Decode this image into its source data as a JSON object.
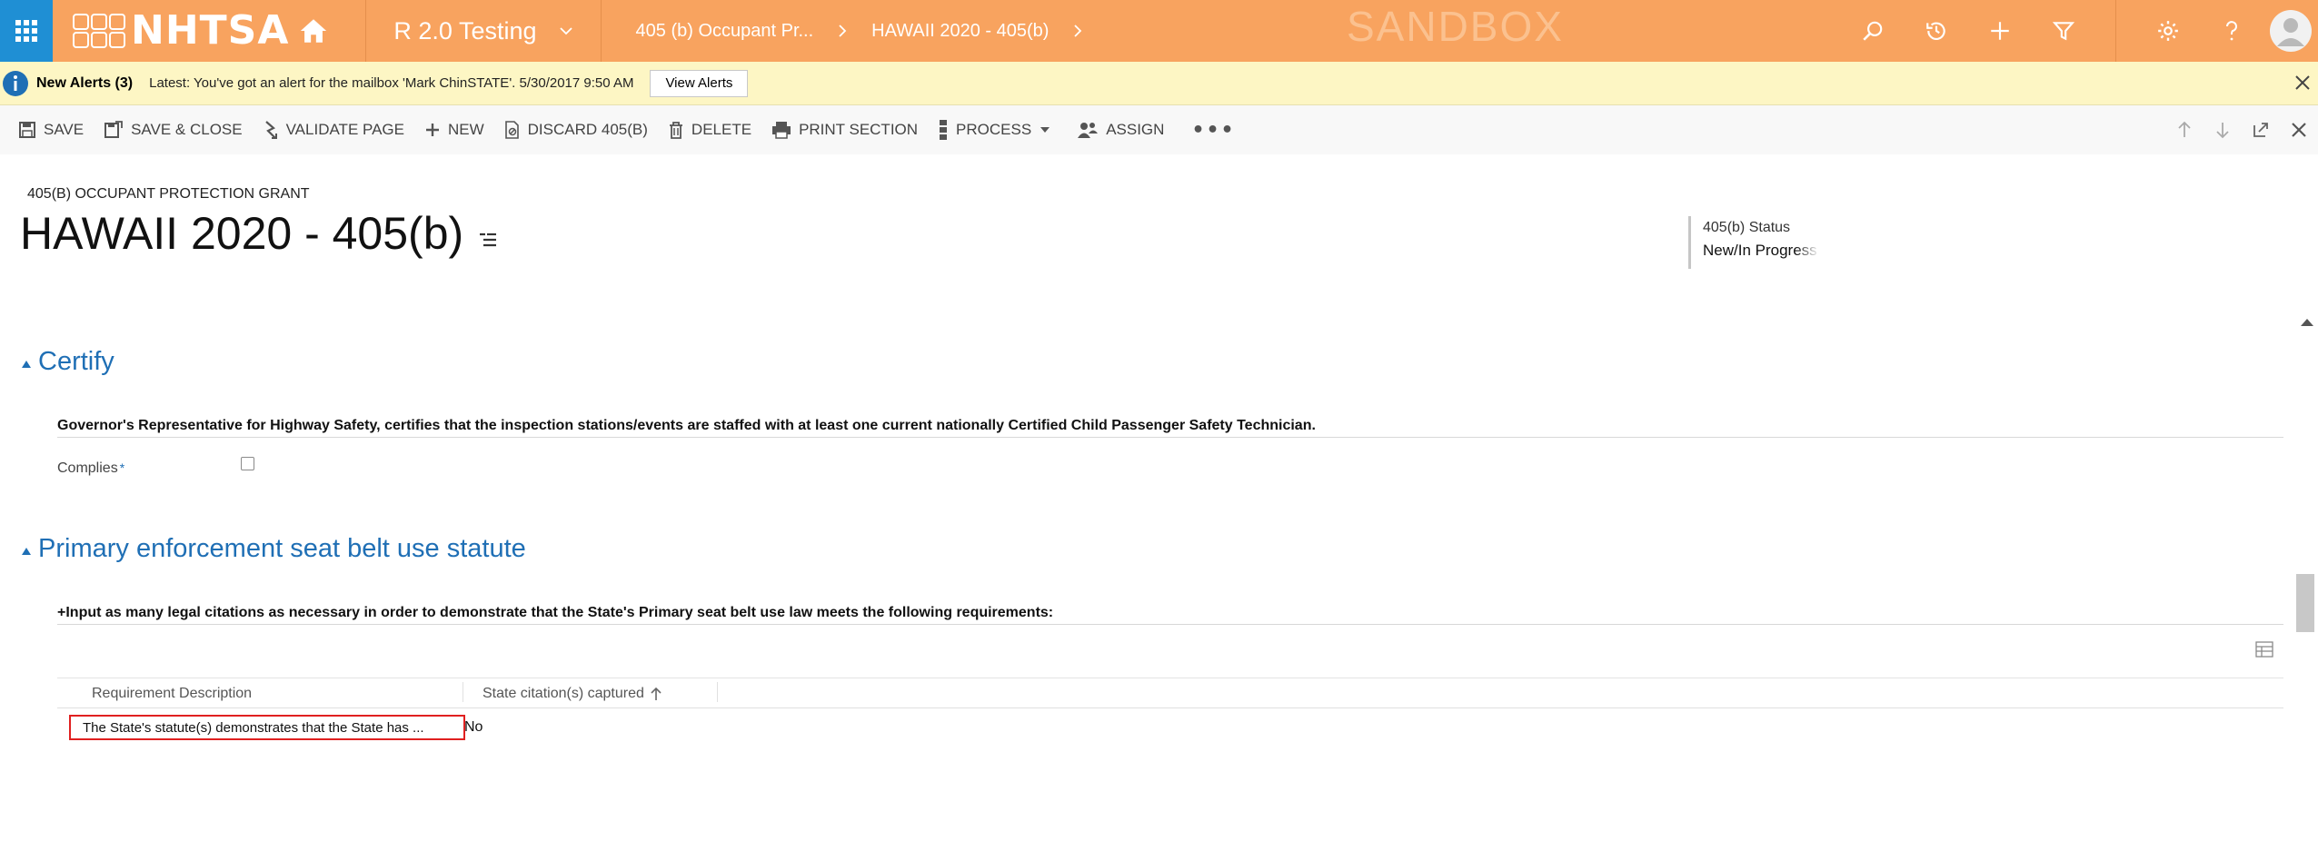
{
  "nav": {
    "logo_text": "NHTSA",
    "area": "R 2.0 Testing",
    "breadcrumb_1": "405 (b) Occupant Pr...",
    "breadcrumb_2": "HAWAII 2020 - 405(b)",
    "sandbox": "SANDBOX"
  },
  "alert": {
    "title": "New Alerts (3)",
    "text": "Latest: You've got an alert for the mailbox 'Mark ChinSTATE'. 5/30/2017 9:50 AM",
    "button": "View Alerts"
  },
  "commands": {
    "save": "SAVE",
    "save_close": "SAVE & CLOSE",
    "validate": "VALIDATE PAGE",
    "new": "NEW",
    "discard": "DISCARD 405(B)",
    "delete": "DELETE",
    "print": "PRINT SECTION",
    "process": "PROCESS",
    "assign": "ASSIGN",
    "more": "•••"
  },
  "header": {
    "entity_type": "405(B) OCCUPANT PROTECTION GRANT",
    "title": "HAWAII 2020 - 405(b)",
    "status_label": "405(b) Status",
    "status_value": "New/In Progress"
  },
  "certify": {
    "title": "Certify",
    "statement": "Governor's Representative for Highway Safety, certifies that the inspection stations/events are staffed with at least one current nationally Certified Child Passenger Safety Technician.",
    "complies_label": "Complies",
    "required_marker": "*"
  },
  "primary": {
    "title": "Primary enforcement seat belt use statute",
    "instruction": "+Input as many legal citations as necessary in order to demonstrate that the State's Primary seat belt use law meets the following requirements:",
    "columns": [
      "Requirement Description",
      "State citation(s) captured"
    ],
    "rows": [
      {
        "description": "The State's statute(s) demonstrates that the State has ...",
        "captured": "No"
      }
    ]
  },
  "colors": {
    "nav_bg": "#f8a35f",
    "waffle_bg": "#1f8fd4",
    "alert_bg": "#fdf6c4",
    "section_blue": "#1f6fb5",
    "highlight_red": "#e02020"
  }
}
